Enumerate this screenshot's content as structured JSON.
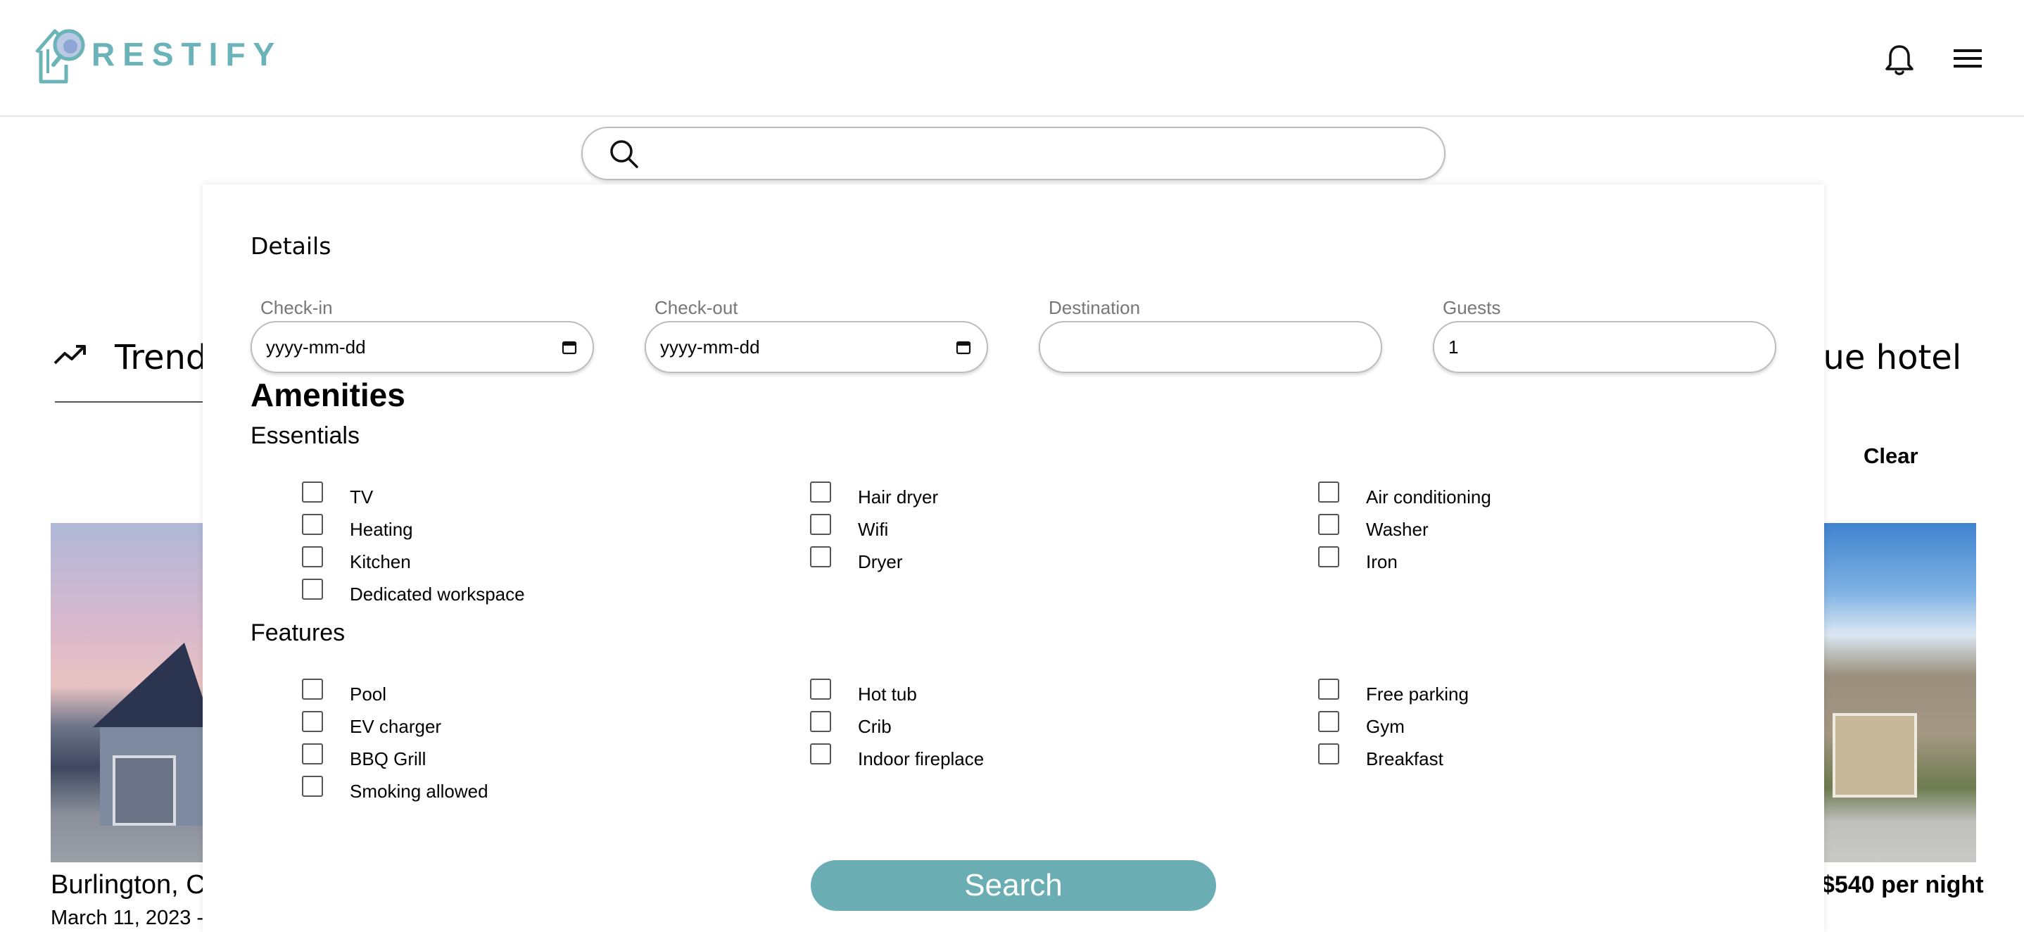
{
  "header": {
    "logo_text": "RESTIFY",
    "brand_color": "#6ab3b9"
  },
  "search": {
    "value": "",
    "placeholder": ""
  },
  "background": {
    "trending_label": "Trendi",
    "right_label": "que hotel",
    "clear_label": "Clear",
    "left_card": {
      "title": "Burlington, C",
      "date": "March 11, 2023 -"
    },
    "right_card": {
      "price": "$540 per night"
    }
  },
  "panel": {
    "details_label": "Details",
    "fields": {
      "checkin": {
        "label": "Check-in",
        "value": "yyyy-mm-dd"
      },
      "checkout": {
        "label": "Check-out",
        "value": "yyyy-mm-dd"
      },
      "destination": {
        "label": "Destination",
        "value": ""
      },
      "guests": {
        "label": "Guests",
        "value": "1"
      }
    },
    "amenities_label": "Amenities",
    "essentials_label": "Essentials",
    "essentials": [
      {
        "label": "TV",
        "checked": false
      },
      {
        "label": "Hair dryer",
        "checked": false
      },
      {
        "label": "Air conditioning",
        "checked": false
      },
      {
        "label": "Heating",
        "checked": false
      },
      {
        "label": "Wifi",
        "checked": false
      },
      {
        "label": "Washer",
        "checked": false
      },
      {
        "label": "Kitchen",
        "checked": false
      },
      {
        "label": "Dryer",
        "checked": false
      },
      {
        "label": "Iron",
        "checked": false
      },
      {
        "label": "Dedicated workspace",
        "checked": false
      }
    ],
    "features_label": "Features",
    "features": [
      {
        "label": "Pool",
        "checked": false
      },
      {
        "label": "Hot tub",
        "checked": false
      },
      {
        "label": "Free parking",
        "checked": false
      },
      {
        "label": "EV charger",
        "checked": false
      },
      {
        "label": "Crib",
        "checked": false
      },
      {
        "label": "Gym",
        "checked": false
      },
      {
        "label": "BBQ Grill",
        "checked": false
      },
      {
        "label": "Indoor fireplace",
        "checked": false
      },
      {
        "label": "Breakfast",
        "checked": false
      },
      {
        "label": "Smoking allowed",
        "checked": false
      }
    ],
    "search_button_label": "Search",
    "search_button_color": "#6aaeb4"
  }
}
